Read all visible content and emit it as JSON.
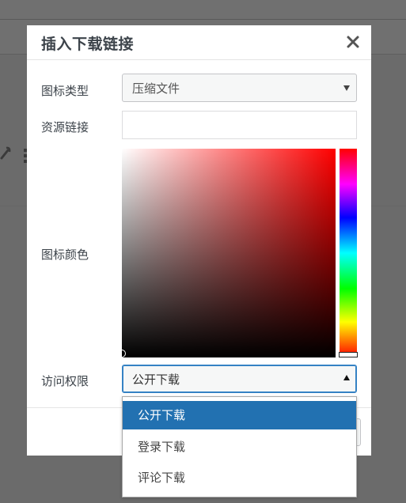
{
  "dialog": {
    "title": "插入下载链接",
    "close_icon": "close-icon"
  },
  "form": {
    "icon_type": {
      "label": "图标类型",
      "value": "压缩文件"
    },
    "resource_link": {
      "label": "资源链接",
      "value": ""
    },
    "icon_color": {
      "label": "图标颜色",
      "hue": "#ff0000"
    },
    "access": {
      "label": "访问权限",
      "value": "公开下载"
    }
  },
  "dropdown": {
    "options": [
      "公开下载",
      "登录下载",
      "评论下载"
    ],
    "highlighted": "公开下载"
  },
  "colors": {
    "accent": "#2271b1",
    "focus_border": "#3582c4",
    "backdrop": "#6b6b6b"
  }
}
